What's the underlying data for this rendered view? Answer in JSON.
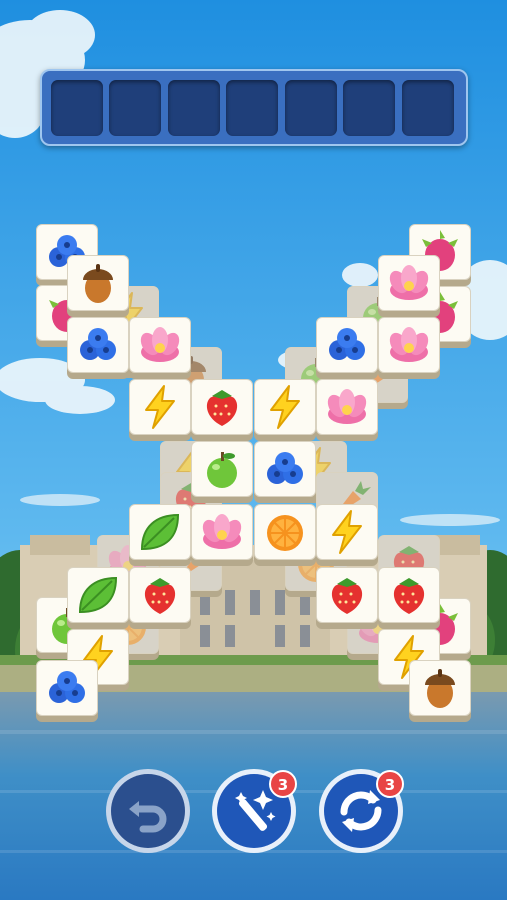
{
  "slot_bar": {
    "slots": 7
  },
  "boosters": {
    "undo": {
      "count": ""
    },
    "magic_wand": {
      "count": "3"
    },
    "shuffle": {
      "count": "3"
    }
  },
  "tile_types": {
    "blueberry": "blueberry-icon",
    "acorn": "acorn-icon",
    "dragonfruit": "dragonfruit-icon",
    "flower": "lotus-flower-icon",
    "lightning": "lightning-icon",
    "strawberry": "strawberry-icon",
    "apple": "green-apple-icon",
    "leaf": "leaf-icon",
    "orange": "orange-slice-icon",
    "carrot": "carrot-icon"
  },
  "colors": {
    "accent": "#3a6fc0",
    "badge": "#e84545",
    "button": "#1f3f7a"
  }
}
